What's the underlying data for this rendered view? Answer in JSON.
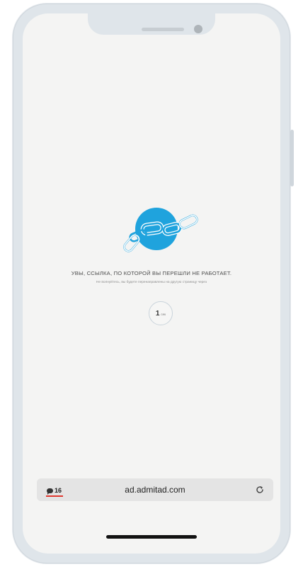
{
  "page": {
    "title": "Увы, ссылка, по которой вы перешли не работает.",
    "subtitle": "Не волнуйтесь, вы будете перенаправлены на другую страницу через",
    "countdown": {
      "value": "1",
      "unit": "сек"
    }
  },
  "browser": {
    "domain": "ad.admitad.com",
    "badge_count": "16",
    "icons": {
      "badge": "comment-bubble-icon",
      "reload": "reload-icon"
    }
  },
  "logo": {
    "name": "broken-chain-logo",
    "color": "#1fa3dd"
  },
  "colors": {
    "accent": "#1fa3dd",
    "alert_underline": "#e0382f"
  }
}
